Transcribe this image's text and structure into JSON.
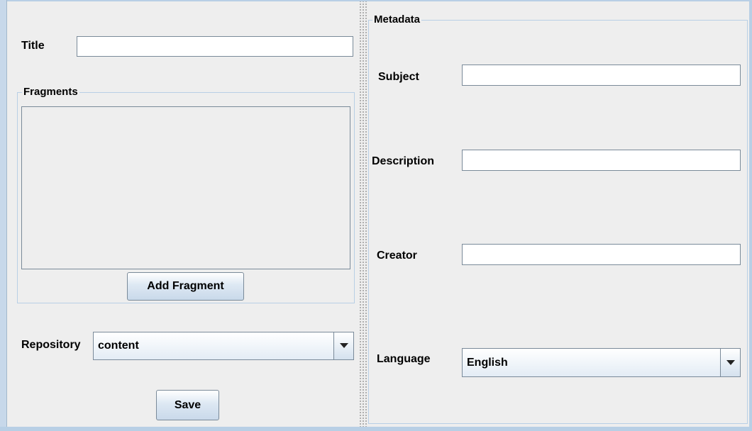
{
  "left_panel": {
    "title_label": "Title",
    "title_value": "",
    "fragments": {
      "group_title": "Fragments",
      "items": [],
      "add_button_label": "Add Fragment"
    },
    "repository": {
      "label": "Repository",
      "selected": "content"
    },
    "save_label": "Save"
  },
  "right_panel": {
    "metadata": {
      "group_title": "Metadata",
      "subject_label": "Subject",
      "subject_value": "",
      "description_label": "Description",
      "description_value": "",
      "creator_label": "Creator",
      "creator_value": "",
      "language_label": "Language",
      "language_selected": "English"
    }
  },
  "icons": {
    "dropdown": "chevron-down-icon"
  },
  "colors": {
    "background": "#eeeeee",
    "border_accent": "#b8cfe5",
    "field_border": "#7a8a99"
  }
}
